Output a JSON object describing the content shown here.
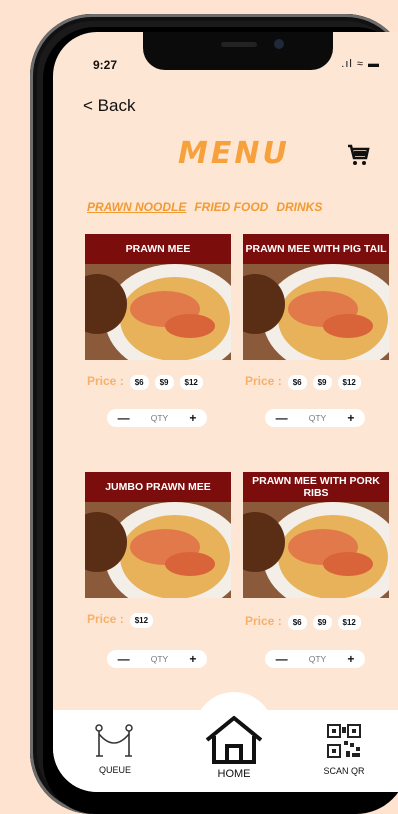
{
  "status_bar": {
    "time": "9:27",
    "icons": ".ıl ≈ ▬"
  },
  "header": {
    "back_label": "< Back",
    "title": "MENU",
    "cart_icon": "cart-icon"
  },
  "tabs": [
    {
      "label": "PRAWN NOODLE",
      "active": true
    },
    {
      "label": "FRIED FOOD",
      "active": false
    },
    {
      "label": "DRINKS",
      "active": false
    }
  ],
  "items": [
    {
      "name": "PRAWN MEE",
      "price_label": "Price :",
      "prices": [
        "$6",
        "$9",
        "$12"
      ],
      "qty_label": "QTY",
      "minus": "—",
      "plus": "+"
    },
    {
      "name": "PRAWN MEE WITH PIG TAIL",
      "price_label": "Price :",
      "prices": [
        "$6",
        "$9",
        "$12"
      ],
      "qty_label": "QTY",
      "minus": "—",
      "plus": "+"
    },
    {
      "name": "JUMBO PRAWN MEE",
      "price_label": "Price :",
      "prices": [
        "$12"
      ],
      "qty_label": "QTY",
      "minus": "—",
      "plus": "+"
    },
    {
      "name": "PRAWN MEE WITH PORK RIBS",
      "price_label": "Price :",
      "prices": [
        "$6",
        "$9",
        "$12"
      ],
      "qty_label": "QTY",
      "minus": "—",
      "plus": "+"
    }
  ],
  "nav": {
    "queue_label": "QUEUE",
    "home_label": "HOME",
    "scan_label": "SCAN QR"
  }
}
